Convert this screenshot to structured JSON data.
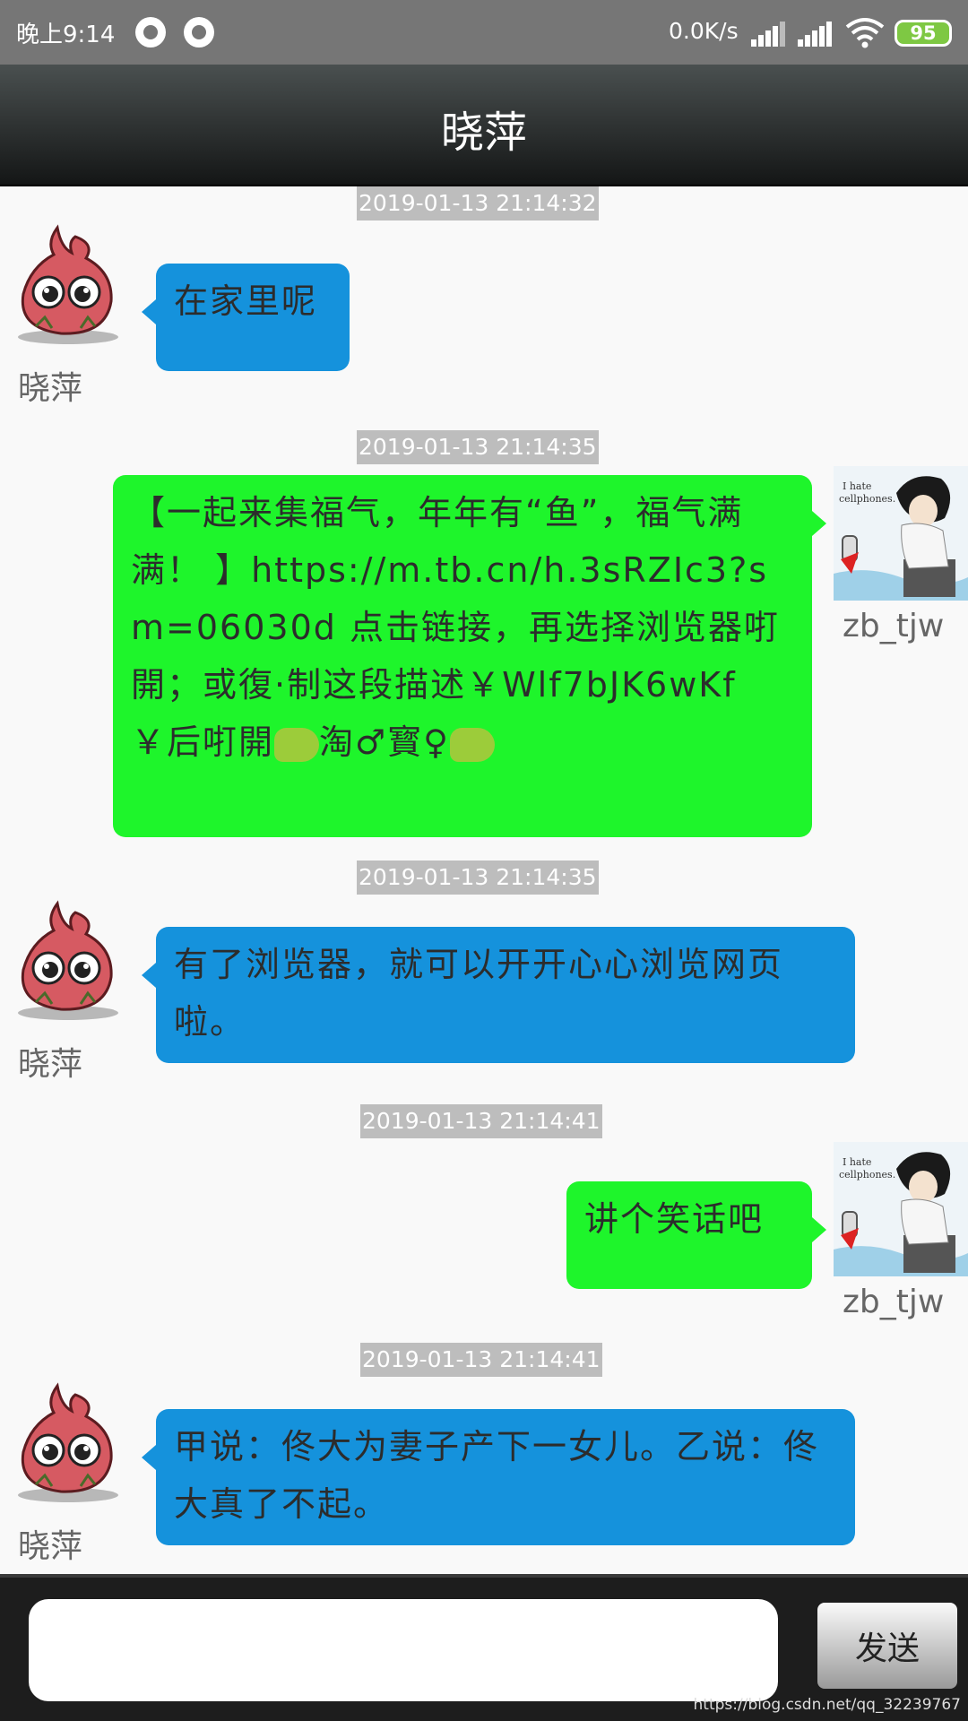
{
  "status_bar": {
    "time": "晚上9:14",
    "network_speed": "0.0K/s",
    "battery": "95",
    "icons": [
      "record-icon",
      "record-icon",
      "signal-icon",
      "signal-icon",
      "wifi-icon",
      "battery-icon"
    ]
  },
  "header": {
    "title": "晓萍"
  },
  "messages": [
    {
      "side": "left",
      "time": "2019-01-13 21:14:32",
      "sender": "晓萍",
      "text": "在家里呢"
    },
    {
      "side": "right",
      "time": "2019-01-13 21:14:35",
      "sender": "zb_tjw",
      "text": "【一起来集福气，年年有“鱼”，福气满满！ 】https://m.tb.cn/h.3sRZIc3?sm=06030d 点击链接，再选择浏览器咑開；或復·制这段描述￥Wlf7bJK6wKf￥后咑開",
      "text_after_hand": "淘♂寳♀"
    },
    {
      "side": "left",
      "time": "2019-01-13 21:14:35",
      "sender": "晓萍",
      "text": "有了浏览器，就可以开开心心浏览网页啦。"
    },
    {
      "side": "right",
      "time": "2019-01-13 21:14:41",
      "sender": "zb_tjw",
      "text": "讲个笑话吧"
    },
    {
      "side": "left",
      "time": "2019-01-13 21:14:41",
      "sender": "晓萍",
      "text": "甲说：佟大为妻子产下一女儿。乙说：佟大真了不起。"
    }
  ],
  "input": {
    "value": "",
    "send_label": "发送"
  },
  "watermark": "https://blog.csdn.net/qq_32239767",
  "colors": {
    "left_bubble": "#1592dc",
    "right_bubble": "#1ef52b",
    "timestamp_bg": "#bdbdbd",
    "header_bg": "#262a2a"
  }
}
